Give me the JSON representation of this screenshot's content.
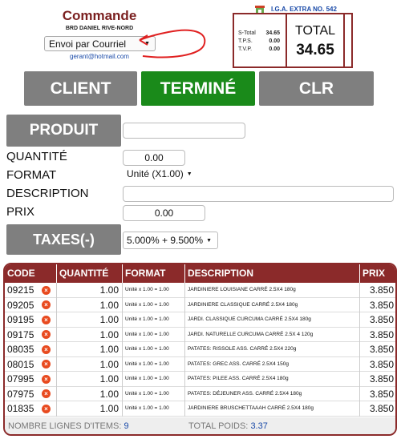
{
  "header": {
    "title": "Commande",
    "store_branch": "BRD DANIEL RIVE-NORD",
    "send_method": "Envoi par Courriel",
    "email": "gerant@hotmail.com",
    "store_name": "I.G.A. EXTRA NO. 542"
  },
  "summary": {
    "subtotal_label": "S-Total",
    "subtotal": "34.65",
    "tps_label": "T.P.S.",
    "tps": "0.00",
    "tvp_label": "T.V.P.",
    "tvp": "0.00",
    "total_label": "TOTAL",
    "total": "34.65"
  },
  "actions": {
    "client": "CLIENT",
    "done": "TERMINÉ",
    "clear": "CLR"
  },
  "form": {
    "product_button": "PRODUIT",
    "quantity_label": "QUANTITÉ",
    "quantity_value": "0.00",
    "format_label": "FORMAT",
    "format_value": "Unité (X1.00)",
    "description_label": "DESCRIPTION",
    "price_label": "PRIX",
    "price_value": "0.00",
    "taxes_button": "TAXES(-)",
    "taxes_value": "5.000% + 9.500%"
  },
  "table": {
    "headers": [
      "CODE",
      "QUANTITÉ",
      "FORMAT",
      "DESCRIPTION",
      "PRIX"
    ],
    "rows": [
      {
        "code": "09215",
        "qty": "1.00",
        "format": "Unité x 1.00 = 1.00",
        "desc": "JARDINIERE LOUISIANE CARRÉ 2.5X4 180g",
        "price": "3.850"
      },
      {
        "code": "09205",
        "qty": "1.00",
        "format": "Unité x 1.00 = 1.00",
        "desc": "JARDINIERE CLASSIQUE CARRÉ 2.5X4 180g",
        "price": "3.850"
      },
      {
        "code": "09195",
        "qty": "1.00",
        "format": "Unité x 1.00 = 1.00",
        "desc": "JARDI. CLASSIQUE CURCUMA CARRÉ 2.5X4 180g",
        "price": "3.850"
      },
      {
        "code": "09175",
        "qty": "1.00",
        "format": "Unité x 1.00 = 1.00",
        "desc": "JARDI. NATURELLE CURCUMA CARRÉ 2.5X 4 120g",
        "price": "3.850"
      },
      {
        "code": "08035",
        "qty": "1.00",
        "format": "Unité x 1.00 = 1.00",
        "desc": "PATATES: RISSOLE ASS. CARRÉ 2.5X4 220g",
        "price": "3.850"
      },
      {
        "code": "08015",
        "qty": "1.00",
        "format": "Unité x 1.00 = 1.00",
        "desc": "PATATES: GREC ASS. CARRÉ 2.5X4 150g",
        "price": "3.850"
      },
      {
        "code": "07995",
        "qty": "1.00",
        "format": "Unité x 1.00 = 1.00",
        "desc": "PATATES: PILEE ASS. CARRÉ 2.5X4 180g",
        "price": "3.850"
      },
      {
        "code": "07975",
        "qty": "1.00",
        "format": "Unité x 1.00 = 1.00",
        "desc": "PATATES: DÉJEUNER ASS. CARRÉ 2.5X4 180g",
        "price": "3.850"
      },
      {
        "code": "01835",
        "qty": "1.00",
        "format": "Unité x 1.00 = 1.00",
        "desc": "JARDINIERE BRUSCHETTAAAH CARRÉ 2.5X4 180g",
        "price": "3.850"
      }
    ],
    "footer_lines_label": "NOMBRE LIGNES D'ITEMS:",
    "footer_lines_value": "9",
    "footer_weight_label": "TOTAL POIDS:",
    "footer_weight_value": "3.37"
  }
}
